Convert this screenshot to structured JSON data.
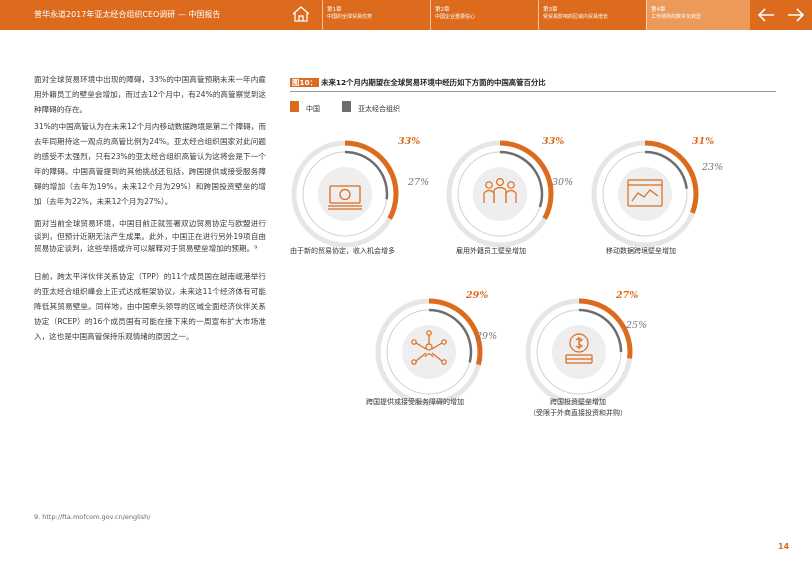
{
  "header": {
    "title": "普华永道2017年亚太经合组织CEO调研 — 中国报告",
    "chapters": [
      {
        "num": "第1章",
        "label": "中国的全球贸易优势"
      },
      {
        "num": "第2章",
        "label": "中国企业重振信心"
      },
      {
        "num": "第3章",
        "label": "受贸易影响的区域内贸易增长"
      },
      {
        "num": "第4章",
        "label": "工作场所的数字化转型"
      }
    ]
  },
  "body": {
    "p1": "面对全球贸易环境中出现的障碍，33%的中国高管预期未来一年内雇用外籍员工的壁垒会增加，而过去12个月中，有24%的高管察觉到这种障碍的存在。",
    "p2": "31%的中国高管认为在未来12个月内移动数据跨境是第二个障碍，而去年同期持这一观点的高管比例为24%。亚太经合组织国家对此问题的感受不太强烈，只有23%的亚太经合组织高管认为这将会是下一个年的障碍。中国高管提到的其他挑战还包括，跨国提供或接受服务障碍的增加（去年为19%，未来12个月为29%）和跨国投资壁垒的增加（去年为22%，未来12个月为27%）。",
    "p3": "面对当前全球贸易环境，中国目前正就签署双边贸易协定与欧盟进行谈判，但预计近期无法产生成果。此外，中国正在进行另外19项自由贸易协定谈判，这些举措或许可以解释对于贸易壁垒增加的预期。⁹",
    "p4": "日前，跨太平洋伙伴关系协定（TPP）的11个成员国在越南岘港举行的亚太经合组织峰会上正式达成框架协议，未来这11个经济体有可能降低其贸易壁垒。同样地，由中国牵头领导的区域全面经济伙伴关系协定（RCEP）的16个成员国有可能在接下来的一周宣布扩大市场准入，这也是中国高管保持乐观情绪的原因之一。"
  },
  "footnote": "9. http://fta.mofcom.gov.cn/english/",
  "page_number": "14",
  "chart_data": {
    "type": "donut",
    "figure_label": "图10：",
    "title": "未来12个月内期望在全球贸易环境中经历如下方面的中国高管百分比",
    "legend": [
      "中国",
      "亚太经合组织"
    ],
    "colors": {
      "china": "#dc6b1e",
      "apec": "#6d6d6d"
    },
    "items": [
      {
        "label": "由于新的贸易协定，收入机会增多",
        "icon": "money-icon",
        "china": 33,
        "apec": 27
      },
      {
        "label": "雇用外籍员工壁垒增加",
        "icon": "people-icon",
        "china": 33,
        "apec": 30
      },
      {
        "label": "移动数据跨境壁垒增加",
        "icon": "browser-chart-icon",
        "china": 31,
        "apec": 23
      },
      {
        "label": "跨国提供或接受服务障碍的增加",
        "icon": "network-person-icon",
        "china": 29,
        "apec": 29
      },
      {
        "label": "跨国投资壁垒增加",
        "sublabel": "（受限于外商直接投资和并购）",
        "icon": "coins-icon",
        "china": 27,
        "apec": 25
      }
    ]
  }
}
